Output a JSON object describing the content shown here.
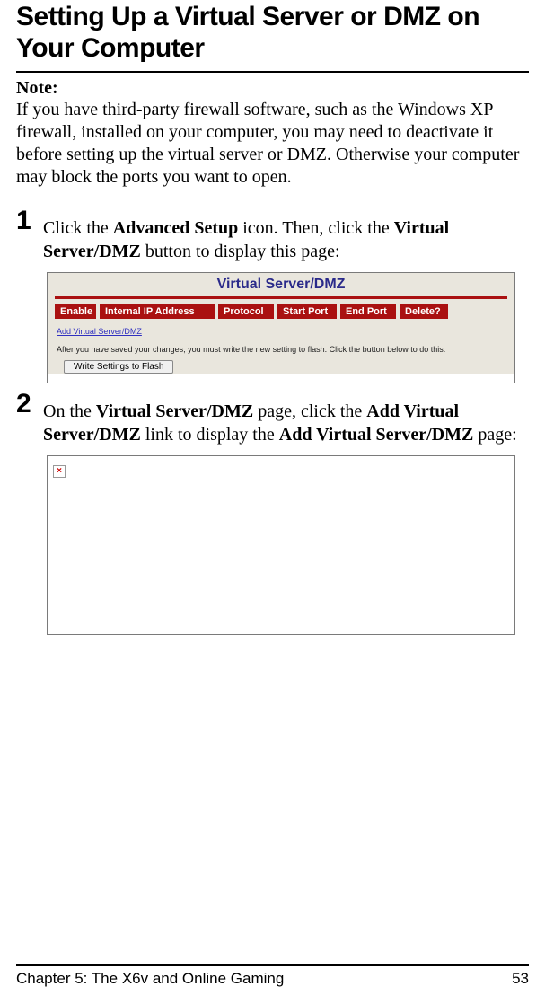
{
  "title": "Setting Up a Virtual Server or DMZ on Your Computer",
  "note": {
    "heading": "Note:",
    "body": "If you have third-party firewall software, such as the Windows XP firewall, installed on your computer, you may need to deactivate it before setting up the virtual server or DMZ. Otherwise your computer may block the ports you want to open."
  },
  "steps": {
    "s1": {
      "num": "1",
      "pre": "Click the ",
      "b1": "Advanced Setup",
      "mid1": " icon. Then, click the ",
      "b2": "Virtual Server/DMZ",
      "post": " button to display this page:"
    },
    "s2": {
      "num": "2",
      "pre": "On the ",
      "b1": "Virtual Server/DMZ",
      "mid1": " page, click the ",
      "b2": "Add Virtual Server/DMZ",
      "mid2": " link to display the ",
      "b3": "Add Virtual Server/DMZ",
      "post": " page:"
    }
  },
  "fig1": {
    "title": "Virtual Server/DMZ",
    "headers": {
      "enable": "Enable",
      "ip": "Internal IP Address",
      "proto": "Protocol",
      "sp": "Start Port",
      "ep": "End Port",
      "del": "Delete?"
    },
    "link": "Add Virtual Server/DMZ",
    "subtext": "After you have saved your changes, you must write the new setting to flash. Click the button below to do this.",
    "button": "Write Settings to Flash"
  },
  "fig2": {
    "broken_alt": "×"
  },
  "footer": {
    "chapter": "Chapter 5: The X6v and Online Gaming",
    "page": "53"
  }
}
